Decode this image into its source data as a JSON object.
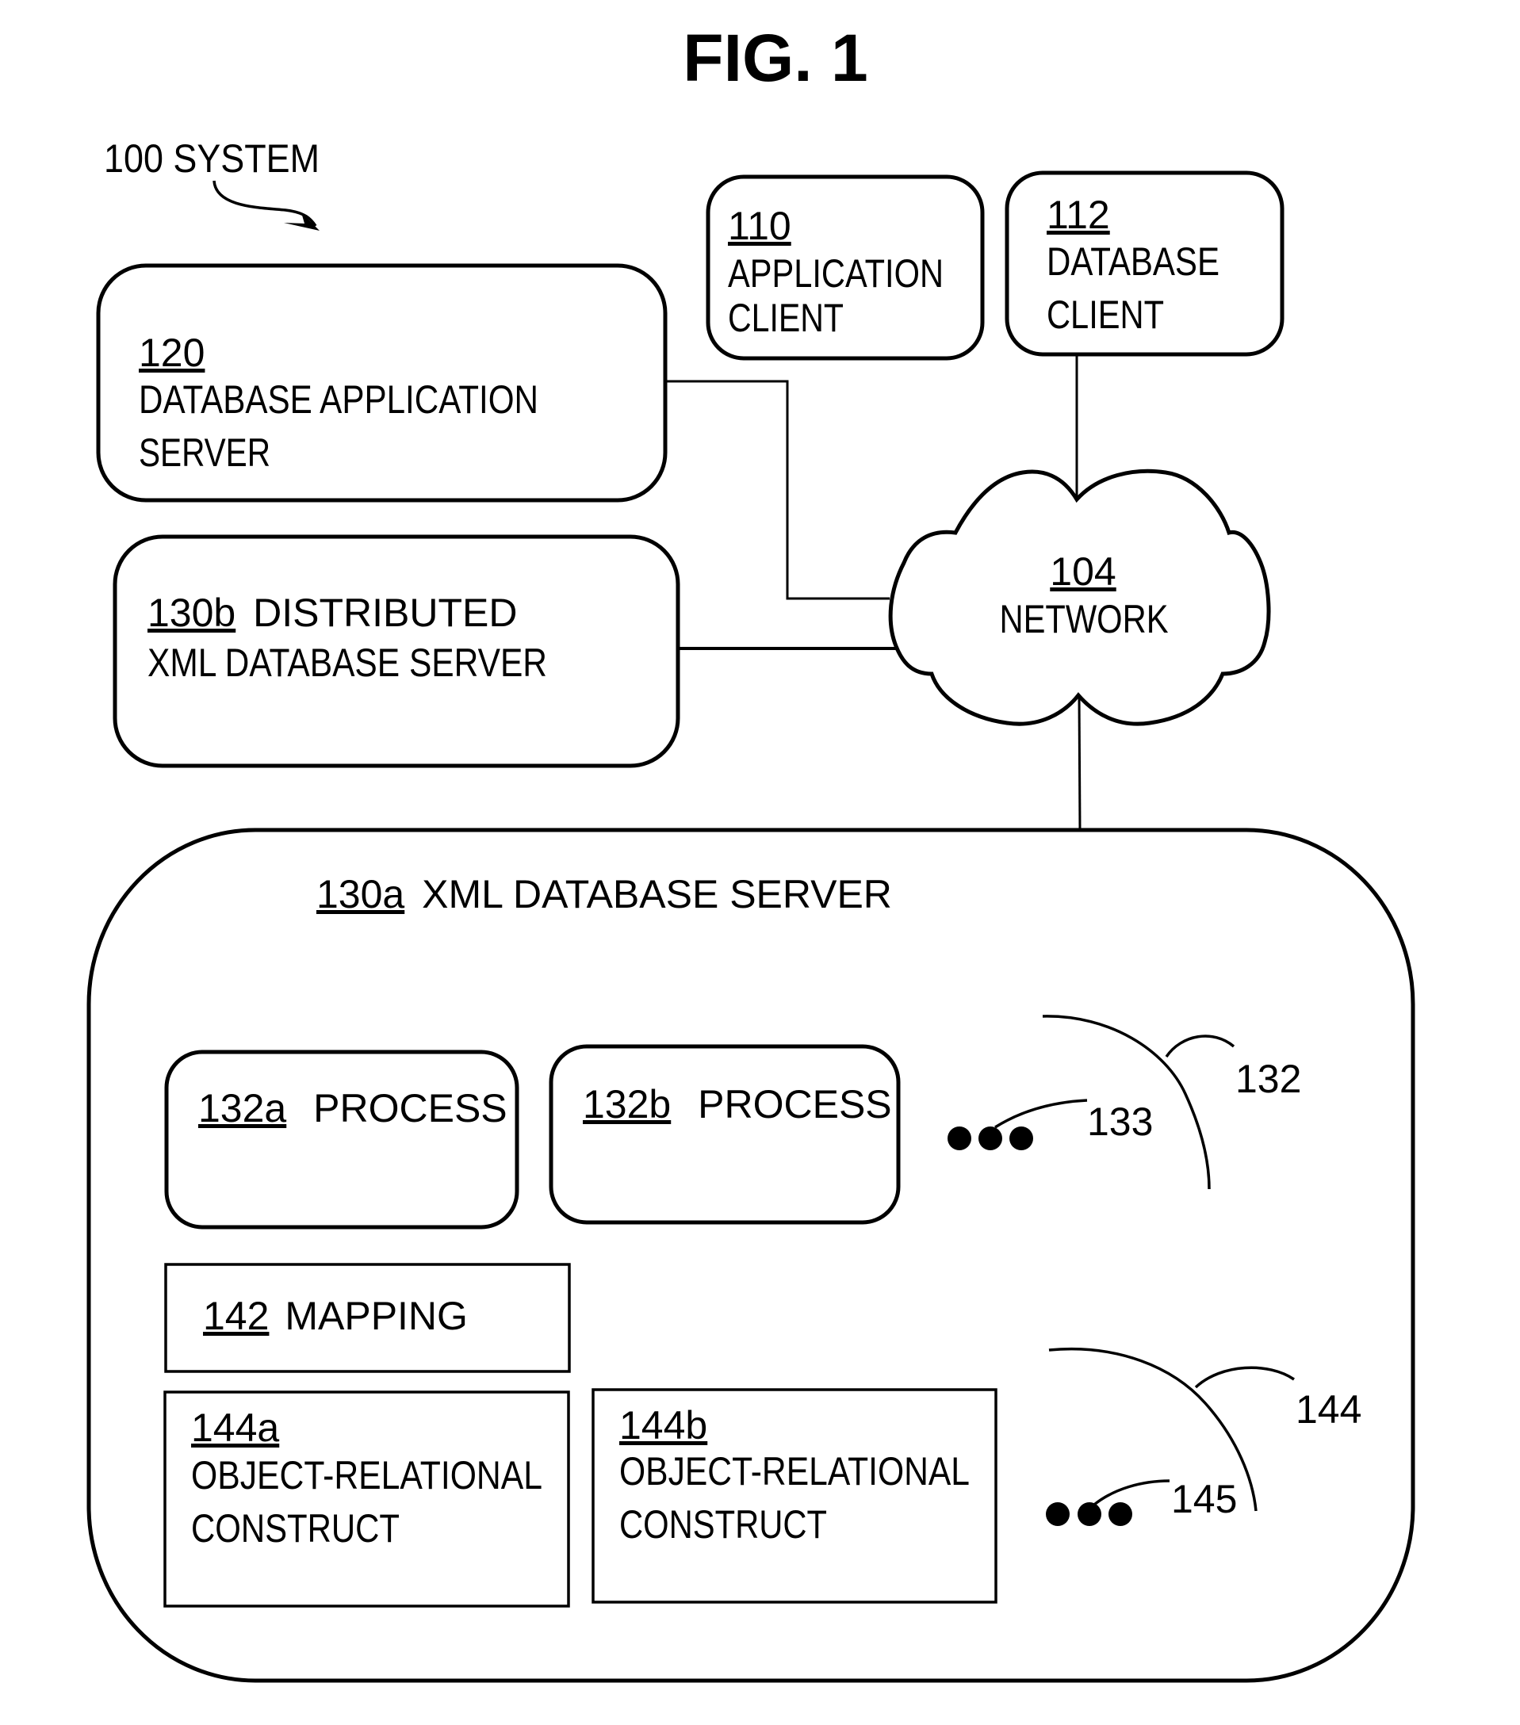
{
  "figure": {
    "title": "FIG. 1",
    "system_label": "100 SYSTEM"
  },
  "nodes": {
    "application_client": {
      "ref": "110",
      "line1": "APPLICATION",
      "line2": "CLIENT"
    },
    "database_client": {
      "ref": "112",
      "line1": "DATABASE",
      "line2": "CLIENT"
    },
    "database_application_server": {
      "ref": "120",
      "line1": "DATABASE APPLICATION",
      "line2": "SERVER"
    },
    "distributed_xml_database_server": {
      "ref": "130b",
      "line1": "DISTRIBUTED",
      "line2": "XML DATABASE SERVER"
    },
    "network": {
      "ref": "104",
      "label": "NETWORK",
      "shape": "cloud-icon"
    },
    "xml_database_server": {
      "ref": "130a",
      "label": "XML DATABASE SERVER",
      "processes": [
        {
          "ref": "132a",
          "label": "PROCESS"
        },
        {
          "ref": "132b",
          "label": "PROCESS"
        }
      ],
      "process_group_ref": "132",
      "process_ellipsis_ref": "133",
      "mapping": {
        "ref": "142",
        "label": "MAPPING"
      },
      "constructs": [
        {
          "ref": "144a",
          "line1": "OBJECT-RELATIONAL",
          "line2": "CONSTRUCT"
        },
        {
          "ref": "144b",
          "line1": "OBJECT-RELATIONAL",
          "line2": "CONSTRUCT"
        }
      ],
      "construct_group_ref": "144",
      "construct_ellipsis_ref": "145"
    }
  },
  "connections": [
    {
      "from": "120",
      "to": "104"
    },
    {
      "from": "130b",
      "to": "104"
    },
    {
      "from": "112",
      "to": "104"
    },
    {
      "from": "104",
      "to": "130a"
    }
  ],
  "colors": {
    "stroke": "#000000",
    "background": "#ffffff"
  }
}
